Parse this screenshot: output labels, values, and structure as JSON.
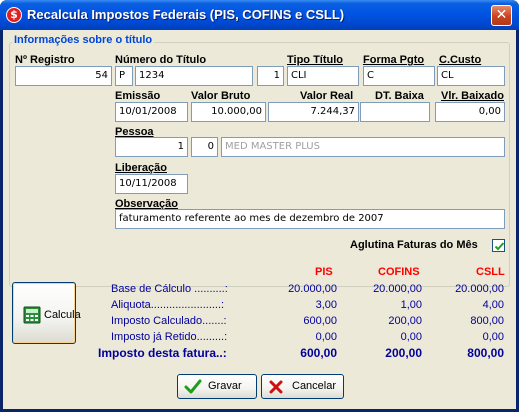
{
  "window": {
    "title": "Recalcula Impostos Federais (PIS, COFINS e CSLL)"
  },
  "group": {
    "title": "Informações sobre o título"
  },
  "labels": {
    "registro": "Nº Registro",
    "numero_titulo": "Número do Título",
    "tipo_titulo": "Tipo Título",
    "forma_pgto": "Forma Pgto",
    "c_custo": "C.Custo",
    "emissao": "Emissão",
    "valor_bruto": "Valor Bruto",
    "valor_real": "Valor Real",
    "dt_baixa": "DT. Baixa",
    "vlr_baixado": "Vlr. Baixado",
    "pessoa": "Pessoa",
    "liberacao": "Liberação",
    "observacao": "Observação",
    "aglutina": "Aglutina Faturas do Mês"
  },
  "fields": {
    "registro": "54",
    "titulo_prefix": "P",
    "numero_titulo": "1234",
    "parcela": "1",
    "tipo_titulo": "CLI",
    "forma_pgto": "C",
    "c_custo": "CL",
    "emissao": "10/01/2008",
    "valor_bruto": "10.000,00",
    "valor_real": "7.244,37",
    "dt_baixa": "",
    "vlr_baixado": "0,00",
    "pessoa_codigo": "1",
    "pessoa_seq": "0",
    "pessoa_nome": "MED MASTER PLUS",
    "liberacao": "10/11/2008",
    "observacao": "faturamento referente ao mes de dezembro de 2007"
  },
  "aglutina_checked": true,
  "taxes": {
    "headers": [
      "PIS",
      "COFINS",
      "CSLL"
    ],
    "rows": [
      {
        "label": "Base de Cálculo ..........:",
        "values": [
          "20.000,00",
          "20.000,00",
          "20.000,00"
        ]
      },
      {
        "label": "Aliquota.......................:",
        "values": [
          "3,00",
          "1,00",
          "4,00"
        ]
      },
      {
        "label": "Imposto Calculado.......:",
        "values": [
          "600,00",
          "200,00",
          "800,00"
        ]
      },
      {
        "label": "Imposto já Retido.........:",
        "values": [
          "0,00",
          "0,00",
          "0,00"
        ]
      }
    ],
    "total": {
      "label": "Imposto desta fatura..:",
      "values": [
        "600,00",
        "200,00",
        "800,00"
      ]
    }
  },
  "buttons": {
    "calcula": "Calcula",
    "gravar": "Gravar",
    "cancelar": "Cancelar"
  },
  "icons": {
    "app": "app-icon",
    "close": "close-icon",
    "calculator": "calculator-icon",
    "check": "check-icon",
    "cancel": "x-icon"
  },
  "colors": {
    "titlebar": "#0054e3",
    "tax_header": "#ff0000",
    "tax_text": "#00009c",
    "group_title": "#0046d5",
    "window_bg": "#ece9d8"
  }
}
